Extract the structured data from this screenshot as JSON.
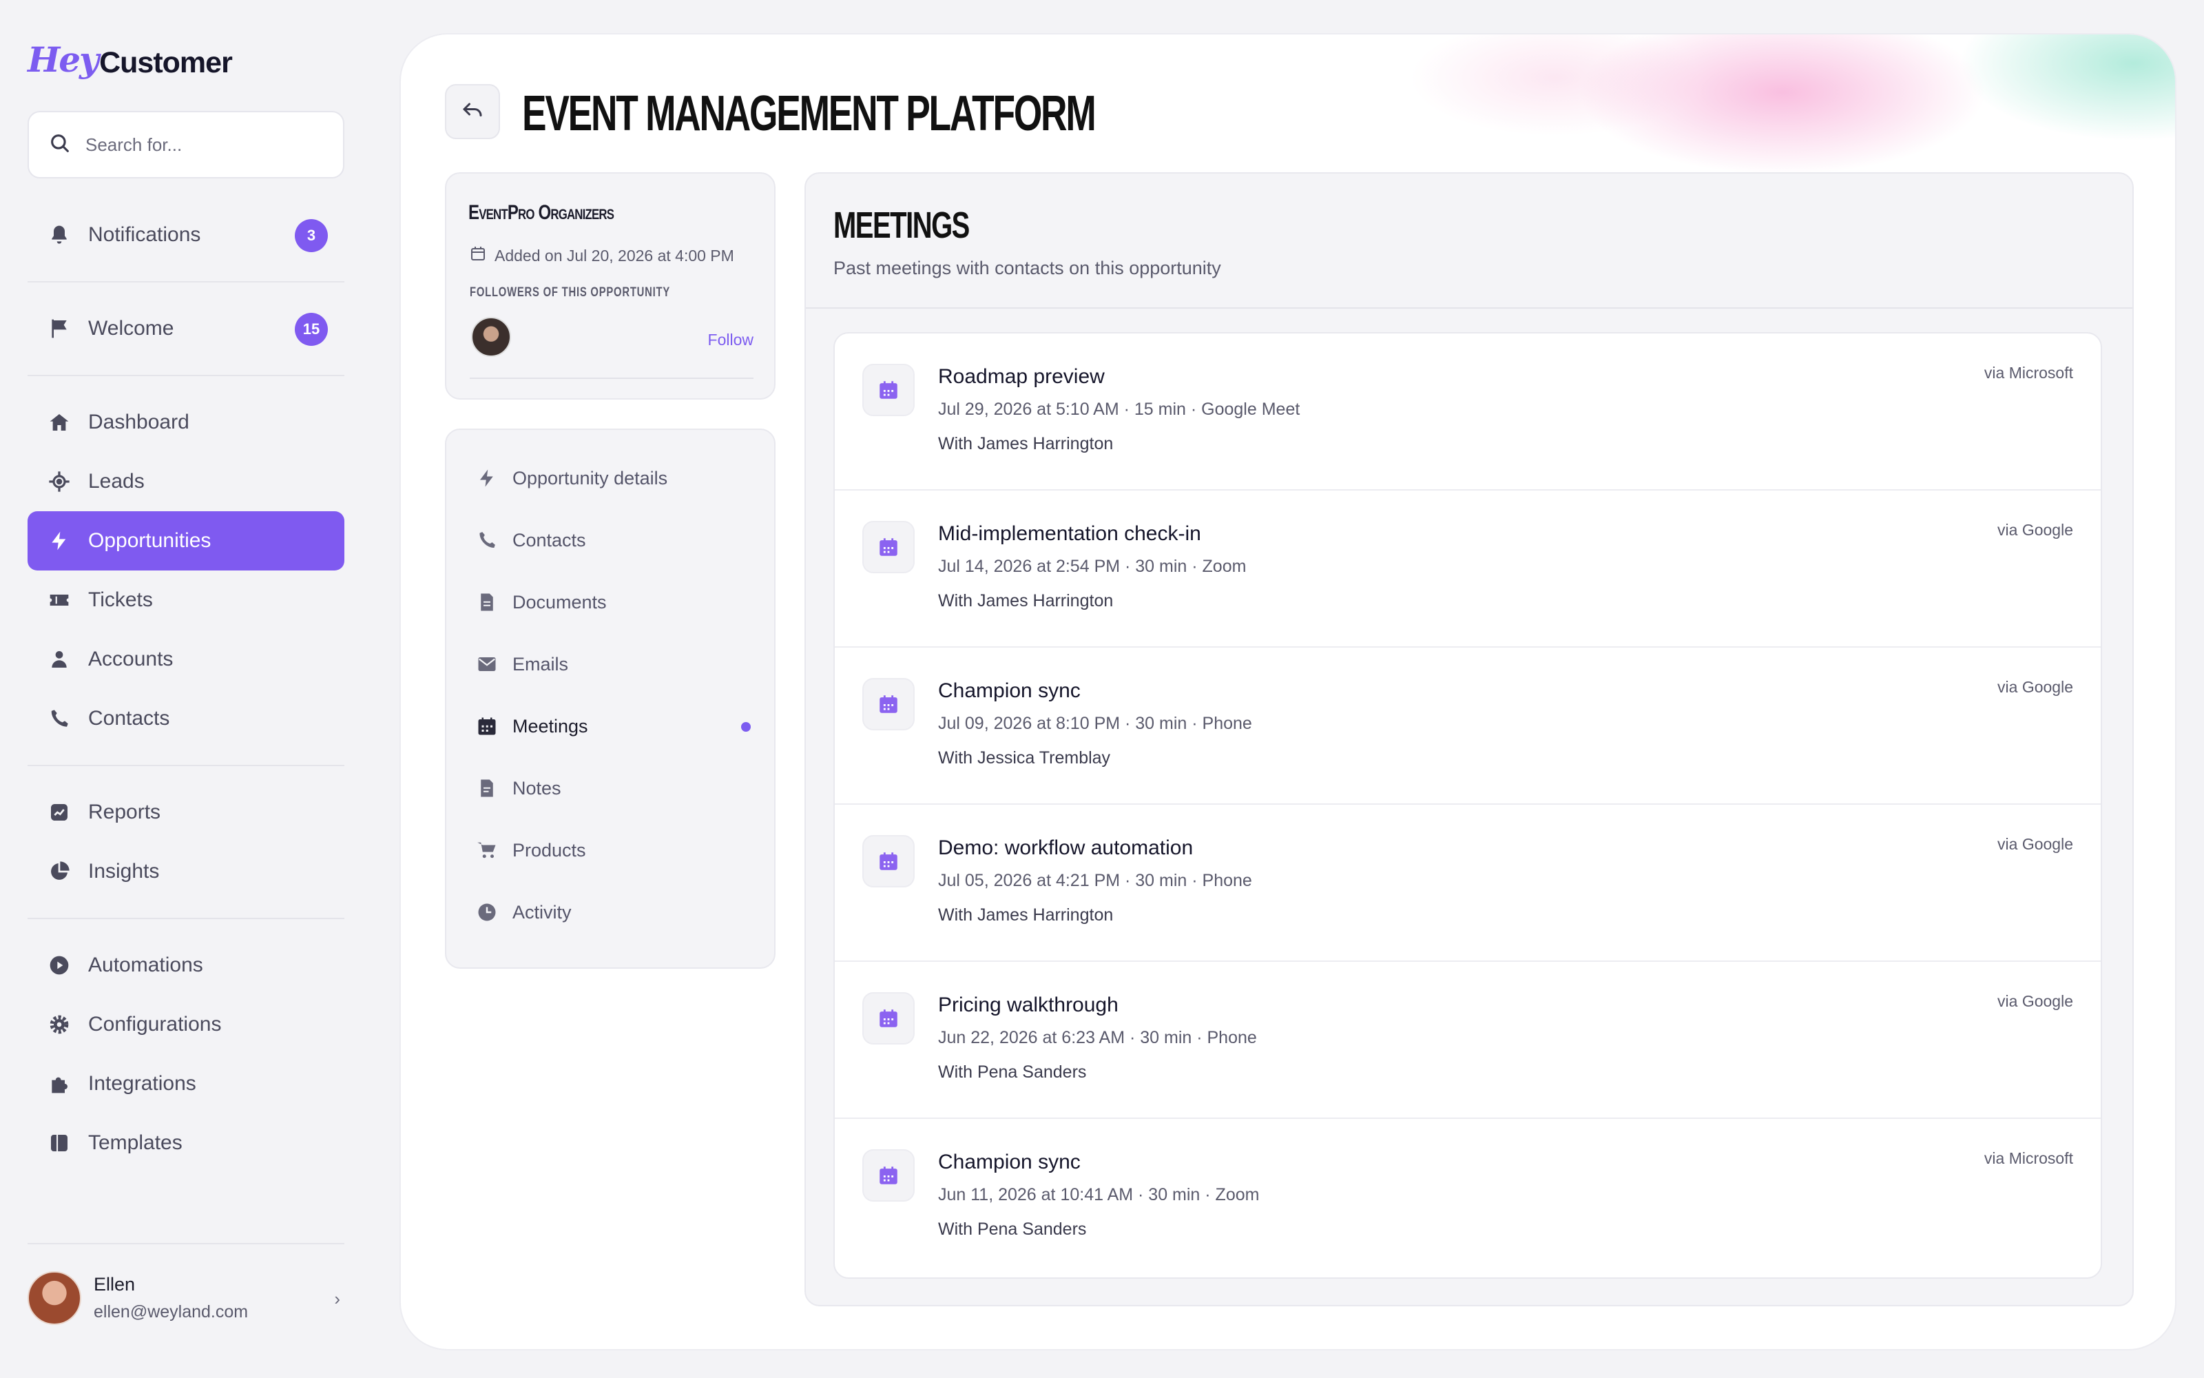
{
  "brand": {
    "prefix": "Hey",
    "suffix": "Customer"
  },
  "search": {
    "placeholder": "Search for..."
  },
  "sidebar": {
    "items": [
      {
        "label": "Notifications",
        "badge": "3",
        "icon": "bell-icon"
      },
      {
        "label": "Welcome",
        "badge": "15",
        "icon": "flag-icon"
      },
      {
        "label": "Dashboard",
        "icon": "home-icon"
      },
      {
        "label": "Leads",
        "icon": "target-icon"
      },
      {
        "label": "Opportunities",
        "icon": "bolt-icon",
        "active": true
      },
      {
        "label": "Tickets",
        "icon": "ticket-icon"
      },
      {
        "label": "Accounts",
        "icon": "user-icon"
      },
      {
        "label": "Contacts",
        "icon": "phone-icon"
      },
      {
        "label": "Reports",
        "icon": "chart-icon"
      },
      {
        "label": "Insights",
        "icon": "pie-icon"
      },
      {
        "label": "Automations",
        "icon": "play-icon"
      },
      {
        "label": "Configurations",
        "icon": "gear-icon"
      },
      {
        "label": "Integrations",
        "icon": "puzzle-icon"
      },
      {
        "label": "Templates",
        "icon": "template-icon"
      }
    ]
  },
  "user": {
    "name": "Ellen",
    "email": "ellen@weyland.com"
  },
  "page": {
    "title": "EVENT MANAGEMENT PLATFORM"
  },
  "company": {
    "name": "EventPro Organizers",
    "added": "Added on Jul 20, 2026 at 4:00 PM",
    "followers_label": "FOLLOWERS OF THIS OPPORTUNITY",
    "follow_label": "Follow"
  },
  "subnav": {
    "items": [
      {
        "label": "Opportunity details",
        "icon": "bolt-icon"
      },
      {
        "label": "Contacts",
        "icon": "phone-icon"
      },
      {
        "label": "Documents",
        "icon": "document-icon"
      },
      {
        "label": "Emails",
        "icon": "mail-icon"
      },
      {
        "label": "Meetings",
        "icon": "calendar-icon",
        "current": true
      },
      {
        "label": "Notes",
        "icon": "note-icon"
      },
      {
        "label": "Products",
        "icon": "cart-icon"
      },
      {
        "label": "Activity",
        "icon": "clock-icon"
      }
    ]
  },
  "meetings": {
    "title": "MEETINGS",
    "subtitle": "Past meetings with contacts on this opportunity",
    "rows": [
      {
        "title": "Roadmap preview",
        "meta": "Jul 29, 2026 at 5:10 AM · 15 min · Google Meet",
        "with": "With James Harrington",
        "via": "via Microsoft"
      },
      {
        "title": "Mid-implementation check-in",
        "meta": "Jul 14, 2026 at 2:54 PM · 30 min · Zoom",
        "with": "With James Harrington",
        "via": "via Google"
      },
      {
        "title": "Champion sync",
        "meta": "Jul 09, 2026 at 8:10 PM · 30 min · Phone",
        "with": "With Jessica Tremblay",
        "via": "via Google"
      },
      {
        "title": "Demo: workflow automation",
        "meta": "Jul 05, 2026 at 4:21 PM · 30 min · Phone",
        "with": "With James Harrington",
        "via": "via Google"
      },
      {
        "title": "Pricing walkthrough",
        "meta": "Jun 22, 2026 at 6:23 AM · 30 min · Phone",
        "with": "With Pena Sanders",
        "via": "via Google"
      },
      {
        "title": "Champion sync",
        "meta": "Jun 11, 2026 at 10:41 AM · 30 min · Zoom",
        "with": "With Pena Sanders",
        "via": "via Microsoft"
      }
    ]
  },
  "colors": {
    "accent": "#7f5af0",
    "text": "#1b1b2a",
    "muted": "#5a5a6c"
  }
}
